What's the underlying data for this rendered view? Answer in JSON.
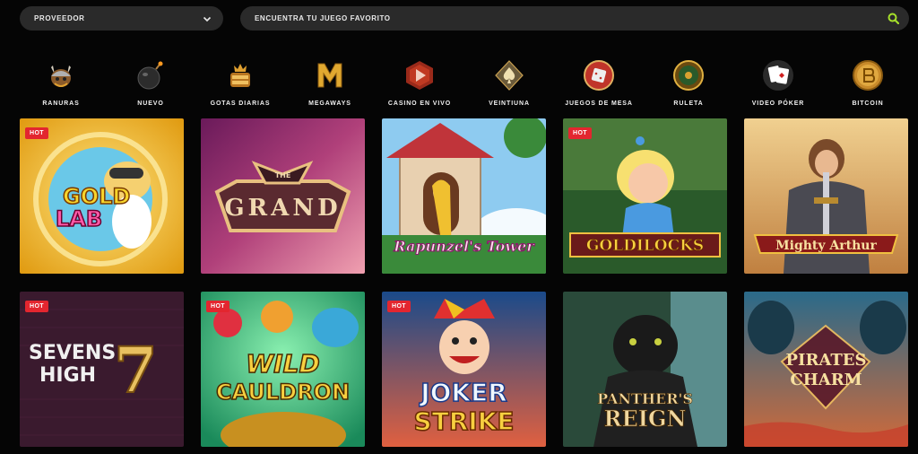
{
  "filters": {
    "provider_label": "PROVEEDOR",
    "search_placeholder": "ENCUENTRA TU JUEGO FAVORITO"
  },
  "categories": [
    {
      "label": "RANURAS",
      "icon": "viking-helmet-icon"
    },
    {
      "label": "NUEVO",
      "icon": "bomb-icon"
    },
    {
      "label": "GOTAS DIARIAS",
      "icon": "drops-wins-icon"
    },
    {
      "label": "MEGAWAYS",
      "icon": "megaways-m-icon"
    },
    {
      "label": "CASINO EN VIVO",
      "icon": "live-casino-play-icon"
    },
    {
      "label": "VEINTIUNA",
      "icon": "spade-icon"
    },
    {
      "label": "JUEGOS DE MESA",
      "icon": "dice-icon"
    },
    {
      "label": "RULETA",
      "icon": "roulette-icon"
    },
    {
      "label": "VIDEO PÓKER",
      "icon": "poker-cards-icon"
    },
    {
      "label": "BITCOIN",
      "icon": "bitcoin-icon"
    }
  ],
  "games": [
    {
      "title": "GOLD LAB",
      "badge": "HOT"
    },
    {
      "title": "THE GRAND",
      "badge": ""
    },
    {
      "title": "Rapunzel's Tower",
      "badge": ""
    },
    {
      "title": "GOLDILOCKS",
      "badge": "HOT"
    },
    {
      "title": "Mighty Arthur",
      "badge": ""
    },
    {
      "title": "SEVENS HIGH",
      "badge": "HOT"
    },
    {
      "title": "WILD CAULDRON",
      "badge": "HOT"
    },
    {
      "title": "JOKER STRIKE",
      "badge": "HOT"
    },
    {
      "title": "PANTHER'S REIGN",
      "badge": ""
    },
    {
      "title": "PIRATES CHARM",
      "badge": ""
    }
  ],
  "colors": {
    "background": "#050505",
    "control_bg": "#2a2a2a",
    "search_accent": "#a6e02a",
    "hot_badge": "#e3262f",
    "category_gold": "#d99a2b"
  }
}
